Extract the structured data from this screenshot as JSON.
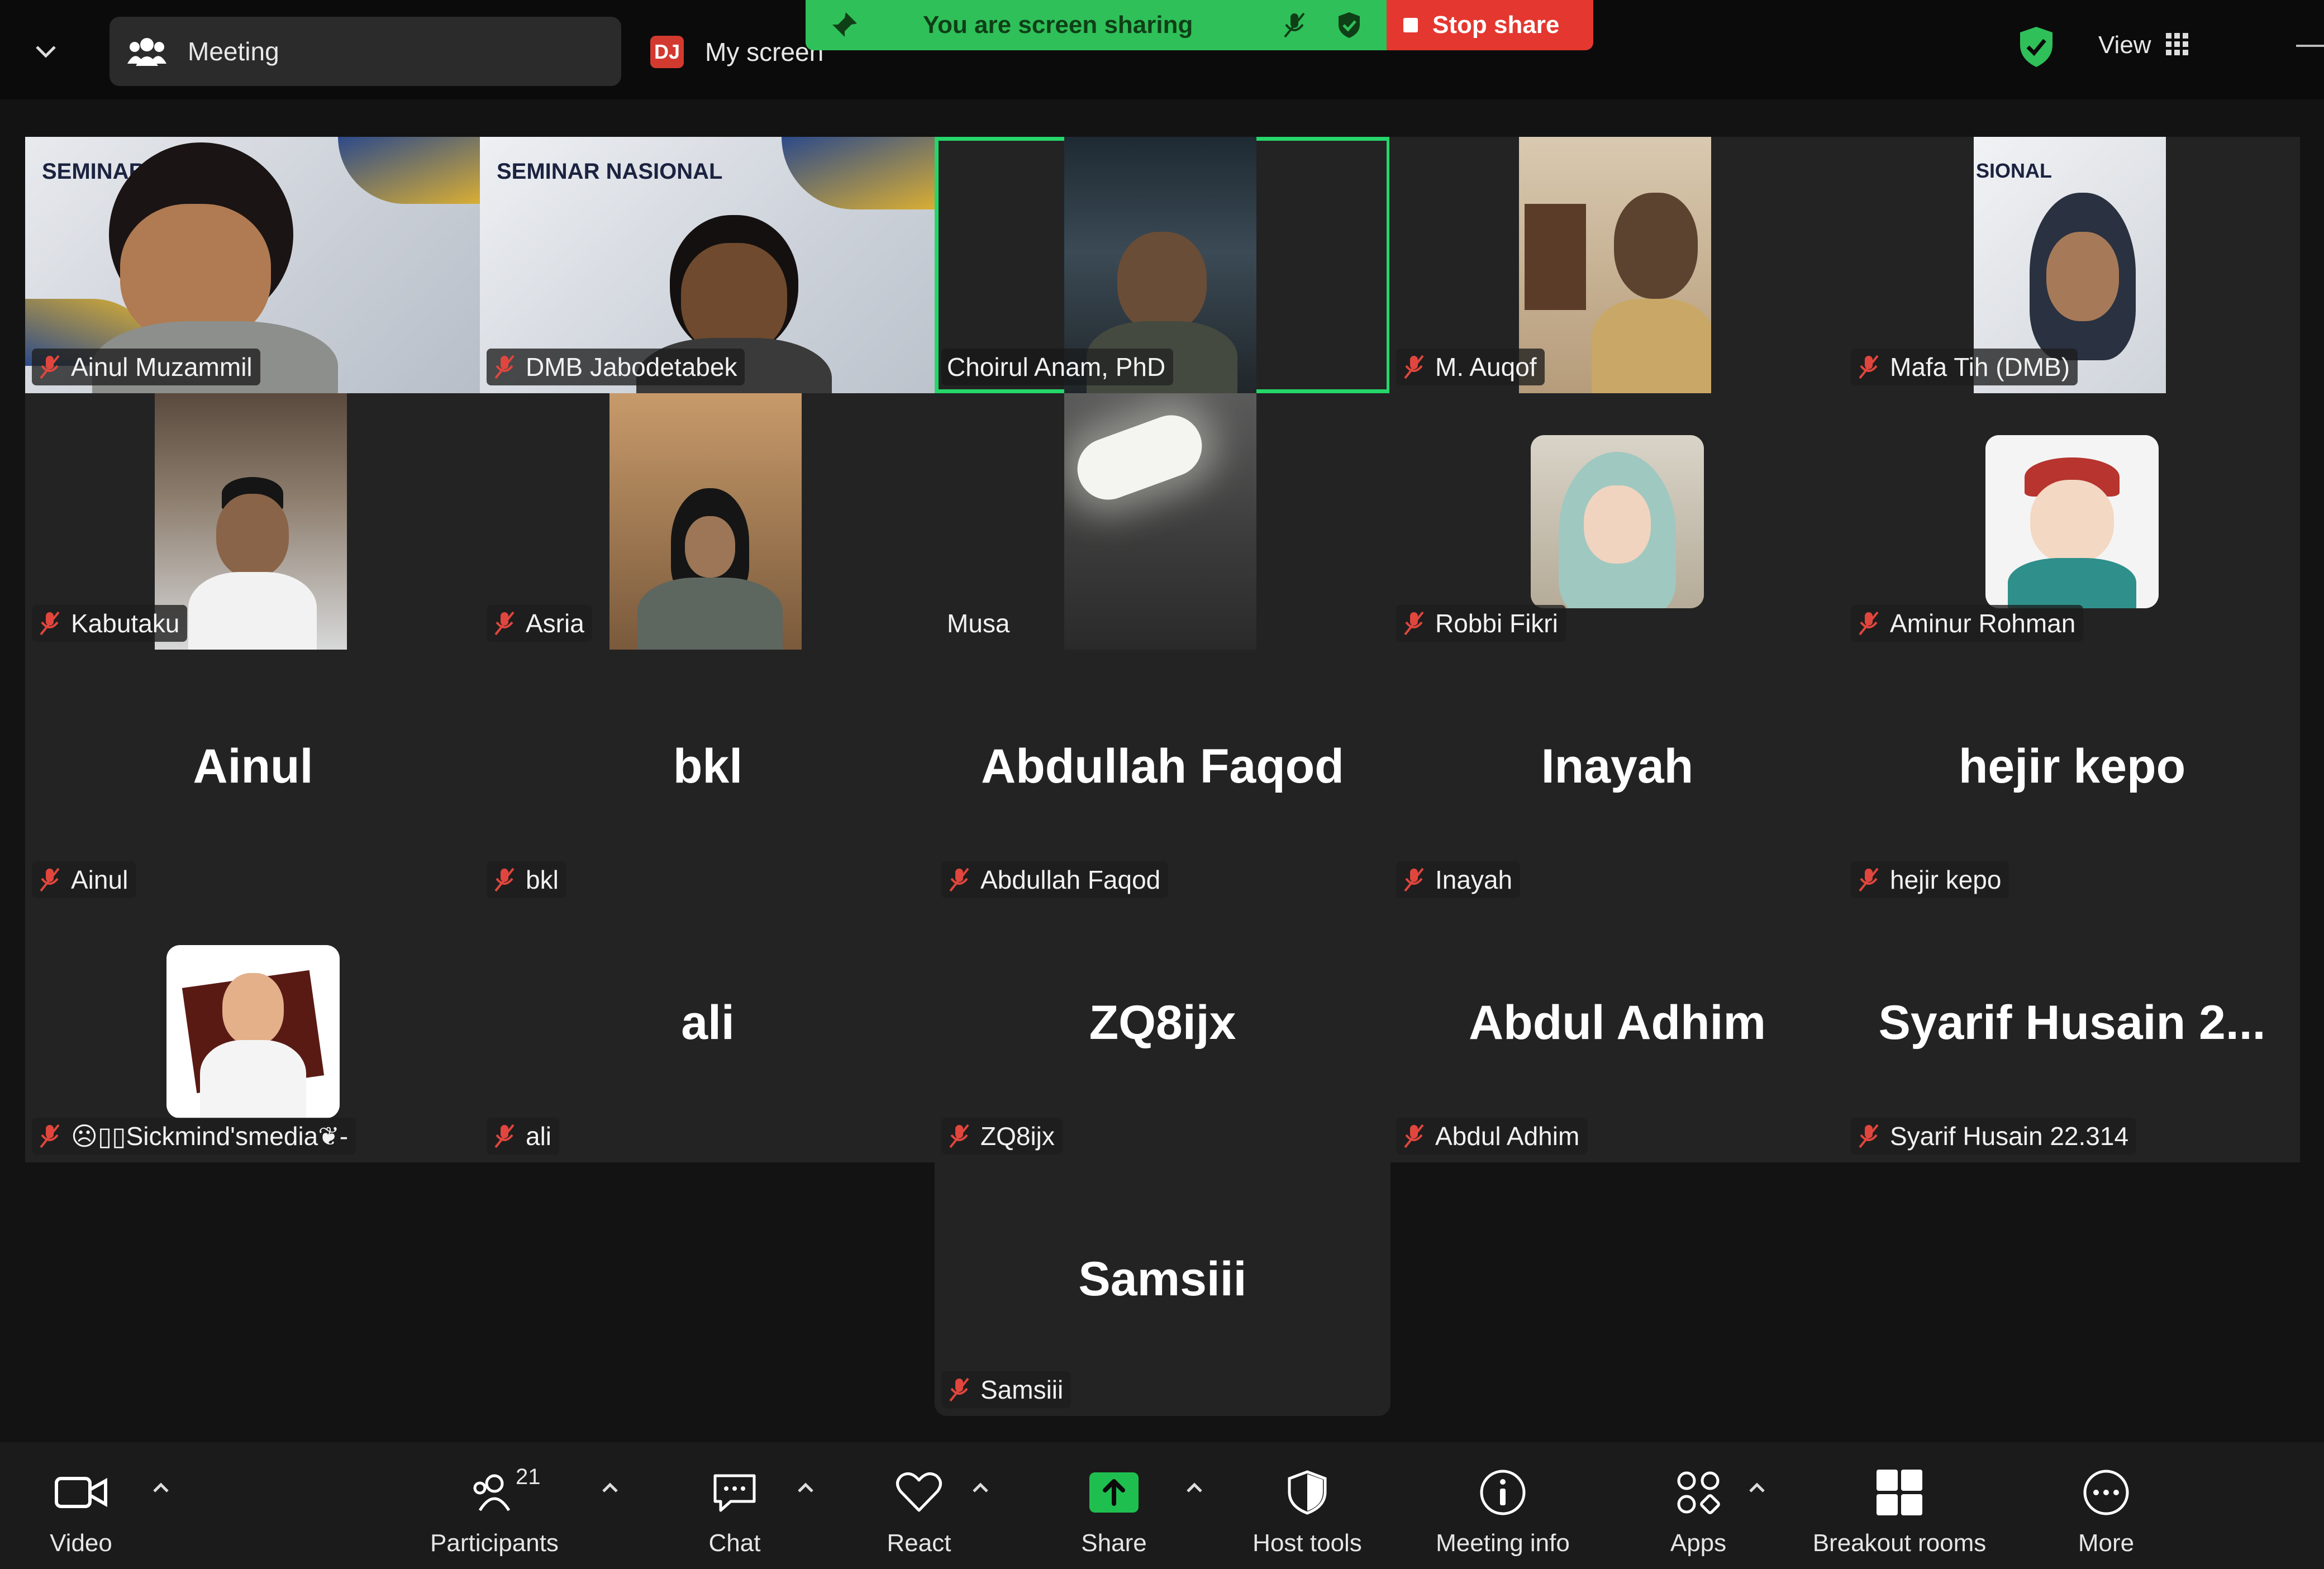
{
  "top_bar": {
    "meeting_label": "Meeting",
    "presenter_badge": "DJ",
    "my_screen_label": "My screen",
    "sharing_banner": "You are screen sharing",
    "stop_share_label": "Stop share",
    "view_label": "View",
    "security_color": "#2fc05a"
  },
  "gallery": {
    "tiles": [
      {
        "name": "Ainul Muzammil",
        "type": "video",
        "muted": true
      },
      {
        "name": "DMB Jabodetabek",
        "type": "video",
        "muted": true
      },
      {
        "name": "Choirul Anam, PhD",
        "type": "video",
        "muted": false,
        "active_speaker": true
      },
      {
        "name": "M. Auqof",
        "type": "video",
        "muted": true
      },
      {
        "name": "Mafa Tih (DMB)",
        "type": "video",
        "muted": true
      },
      {
        "name": "Kabutaku",
        "type": "video",
        "muted": true
      },
      {
        "name": "Asria",
        "type": "video",
        "muted": true
      },
      {
        "name": "Musa",
        "type": "video",
        "muted": false
      },
      {
        "name": "Robbi Fikri",
        "type": "avatar",
        "muted": true
      },
      {
        "name": "Aminur Rohman",
        "type": "avatar",
        "muted": true
      },
      {
        "name": "Ainul",
        "display": "Ainul",
        "type": "name",
        "muted": true
      },
      {
        "name": "bkl",
        "display": "bkl",
        "type": "name",
        "muted": true
      },
      {
        "name": "Abdullah Faqod",
        "display": "Abdullah Faqod",
        "type": "name",
        "muted": true
      },
      {
        "name": "Inayah",
        "display": "Inayah",
        "type": "name",
        "muted": true
      },
      {
        "name": "hejir kepo",
        "display": "hejir kepo",
        "type": "name",
        "muted": true
      },
      {
        "name": "☹︎▯▯Sickmind'smedia❦-",
        "type": "avatar",
        "muted": true
      },
      {
        "name": "ali",
        "display": "ali",
        "type": "name",
        "muted": true
      },
      {
        "name": "ZQ8ijx",
        "display": "ZQ8ijx",
        "type": "name",
        "muted": true
      },
      {
        "name": "Abdul Adhim",
        "display": "Abdul Adhim",
        "type": "name",
        "muted": true
      },
      {
        "name": "Syarif Husain 22.314",
        "display": "Syarif Husain 2...",
        "type": "name",
        "muted": true
      },
      {
        "name": "Samsiii",
        "display": "Samsiii",
        "type": "name",
        "muted": true
      }
    ],
    "slide_title_1": "SEMINAR",
    "slide_title_2": "SEMINAR NASIONAL",
    "slide_title_3": "SIONAL",
    "active_border_color": "#25d66a",
    "muted_icon_color": "#e0463d"
  },
  "toolbar": {
    "video_label": "Video",
    "participants_label": "Participants",
    "participants_count": "21",
    "chat_label": "Chat",
    "react_label": "React",
    "share_label": "Share",
    "host_tools_label": "Host tools",
    "meeting_info_label": "Meeting info",
    "apps_label": "Apps",
    "breakout_label": "Breakout rooms",
    "more_label": "More",
    "share_color": "#1fbf4f"
  }
}
